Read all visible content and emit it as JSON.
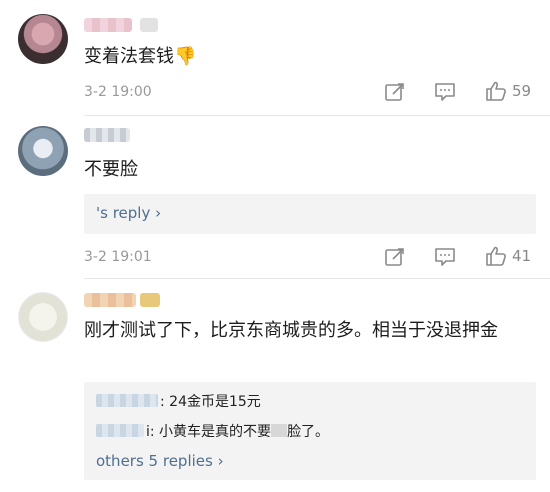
{
  "comments": [
    {
      "text": "变着法套钱👎",
      "time": "3-2 19:00",
      "likes": "59"
    },
    {
      "text": "不要脸",
      "reply_link": "'s reply ›",
      "time": "3-2 19:01",
      "likes": "41"
    },
    {
      "text": "刚才测试了下，比京东商城贵的多。相当于没退押金",
      "replies": [
        {
          "text": ": 24金币是15元"
        },
        {
          "text_before": "i: 小黄车是真的不要",
          "text_after": "脸了。"
        }
      ],
      "more_replies": "others 5 replies ›"
    }
  ],
  "icons": {
    "repost": "repost-icon",
    "comment": "comment-icon",
    "like": "like-icon"
  }
}
